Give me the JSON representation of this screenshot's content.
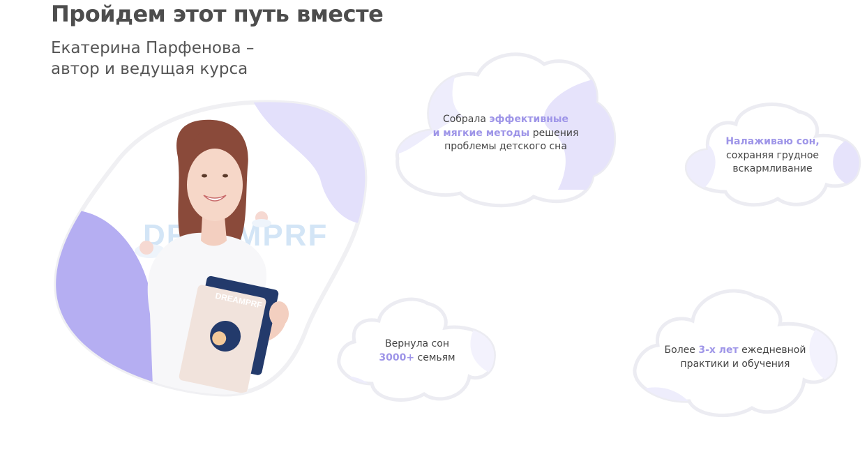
{
  "header": {
    "title": "Пройдем этот путь вместе",
    "subtitle_line1": "Екатерина Парфенова –",
    "subtitle_line2": "автор и ведущая курса"
  },
  "photo": {
    "logo_text": "DREAMPRF",
    "notebook_text": "DREAMPRF"
  },
  "colors": {
    "accent": "#9e95e8",
    "blob_light": "#e3e0fb",
    "blob_mid": "#b5aef2",
    "text": "#444444"
  },
  "clouds": {
    "methods": {
      "l1_a": "Собрала ",
      "l1_b": "эффективные",
      "l2_a": "и мягкие методы",
      "l2_b": " решения",
      "l3": "проблемы детского сна"
    },
    "sleep": {
      "l1": "Налаживаю сон,",
      "l2": "сохраняя грудное",
      "l3": "вскармливание"
    },
    "families": {
      "l1": "Вернула сон",
      "l2_a": "3000+",
      "l2_b": " семьям"
    },
    "experience": {
      "l1_a": "Более ",
      "l1_b": "3-х лет",
      "l1_c": " ежедневной",
      "l2": "практики и обучения"
    }
  }
}
